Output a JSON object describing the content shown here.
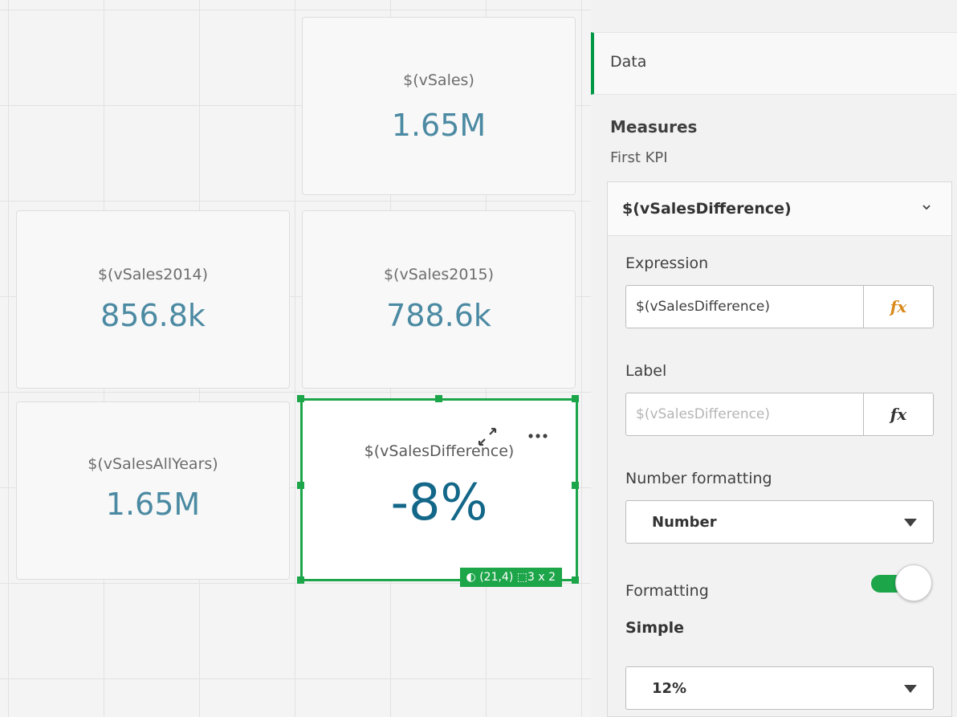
{
  "sheet": {
    "kpis": [
      {
        "title": "$(vSales)",
        "value": "1.65M"
      },
      {
        "title": "$(vSales2014)",
        "value": "856.8k"
      },
      {
        "title": "$(vSales2015)",
        "value": "788.6k"
      },
      {
        "title": "$(vSalesAllYears)",
        "value": "1.65M"
      },
      {
        "title": "$(vSalesDifference)",
        "value": "-8%"
      }
    ],
    "selected": {
      "status_position": "(21,4)",
      "status_size": "3 x 2"
    }
  },
  "panel": {
    "tab_label": "Data",
    "section_title": "Measures",
    "subtitle": "First KPI",
    "measure": {
      "name": "$(vSalesDifference)",
      "expression_label": "Expression",
      "expression_value": "$(vSalesDifference)",
      "label_label": "Label",
      "label_placeholder": "$(vSalesDifference)",
      "fx_label": "fx",
      "number_formatting_label": "Number formatting",
      "number_formatting_value": "Number",
      "formatting_label": "Formatting",
      "formatting_mode": "Simple",
      "formatting_value": "12%",
      "formatting_toggle_on": true
    }
  },
  "colors": {
    "accent_green": "#1da54a",
    "kpi_value": "#4b8aa2",
    "kpi_selected_value": "#136788",
    "fx_expression": "#d88a1c",
    "fx_label": "#333333"
  }
}
